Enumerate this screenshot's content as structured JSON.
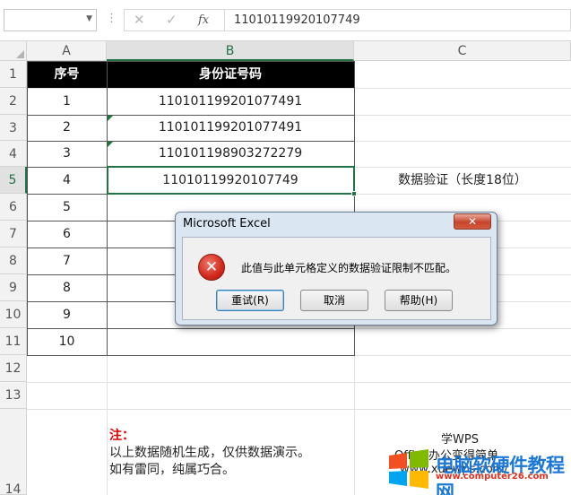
{
  "formula_bar": {
    "name_box": "",
    "cancel_glyph": "✕",
    "enter_glyph": "✓",
    "fx_label": "fx",
    "formula": "11010119920107749"
  },
  "columns": [
    "A",
    "B",
    "C"
  ],
  "rows": [
    "1",
    "2",
    "3",
    "4",
    "5",
    "6",
    "7",
    "8",
    "9",
    "10",
    "11",
    "12",
    "13",
    "14"
  ],
  "table": {
    "header": [
      "序号",
      "身份证号码"
    ],
    "rows": [
      [
        "1",
        "110101199201077491"
      ],
      [
        "2",
        "110101199201077491"
      ],
      [
        "3",
        "110101198903272279"
      ],
      [
        "4",
        "11010119920107749"
      ],
      [
        "5",
        ""
      ],
      [
        "6",
        ""
      ],
      [
        "7",
        ""
      ],
      [
        "8",
        ""
      ],
      [
        "9",
        ""
      ],
      [
        "10",
        ""
      ]
    ]
  },
  "c5_text": "数据验证（长度18位）",
  "note": {
    "title": "注：",
    "line1": "以上数据随机生成，仅供数据演示。",
    "line2": "如有雷同，纯属巧合。"
  },
  "watermark": {
    "top": "学WPS",
    "mid": "Office办公变得简单",
    "url2": "www.xuewps.com/",
    "brand": "电脑软硬件教程网",
    "url": "www.computer26.com"
  },
  "dialog": {
    "title": "Microsoft Excel",
    "close": "✕",
    "icon": "✕",
    "message": "此值与此单元格定义的数据验证限制不匹配。",
    "retry": "重试(R)",
    "cancel": "取消",
    "help": "帮助(H)"
  },
  "colors": {
    "accent": "#217346",
    "header_bg": "#000000",
    "error_red": "#d0281b"
  }
}
